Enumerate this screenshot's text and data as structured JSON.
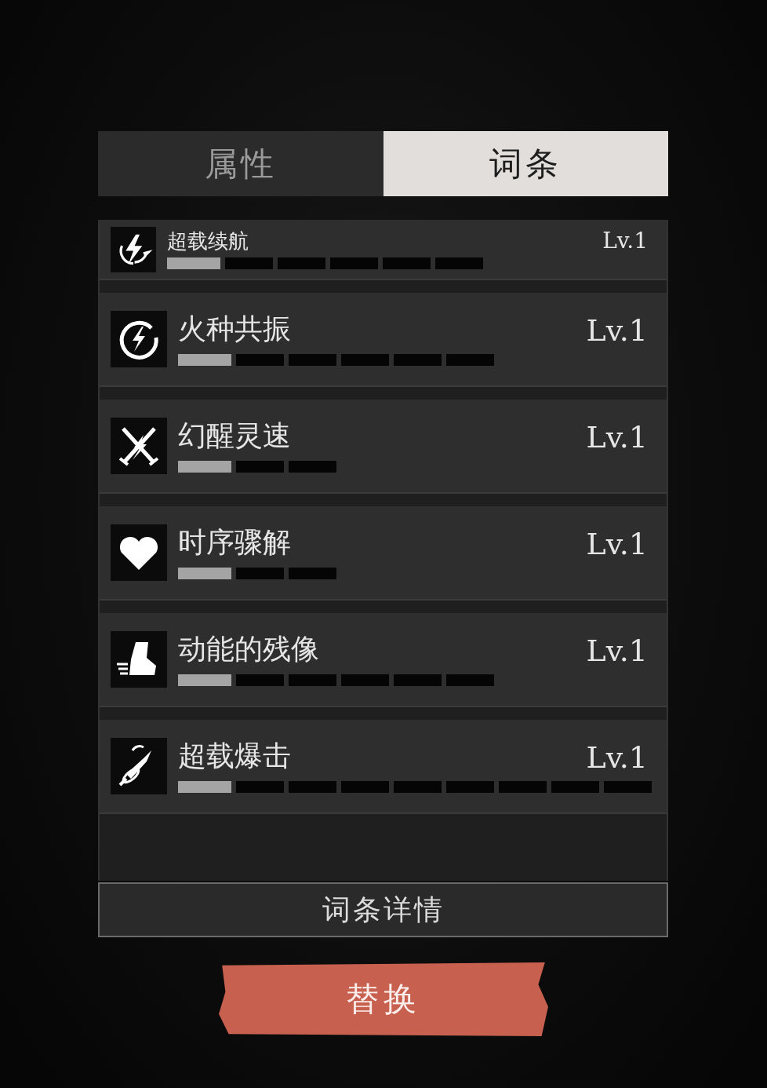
{
  "tabs": [
    {
      "label": "属性",
      "selected": false
    },
    {
      "label": "词条",
      "selected": true
    }
  ],
  "entries": [
    {
      "name": "超载续航",
      "level_text": "Lv.1",
      "pips": [
        {
          "filled": true
        },
        {
          "filled": false
        },
        {
          "filled": false
        },
        {
          "filled": false
        },
        {
          "filled": false
        },
        {
          "filled": false
        }
      ]
    },
    {
      "name": "火种共振",
      "level_text": "Lv.1",
      "pips": [
        {
          "filled": true
        },
        {
          "filled": false
        },
        {
          "filled": false
        },
        {
          "filled": false
        },
        {
          "filled": false
        },
        {
          "filled": false
        }
      ]
    },
    {
      "name": "幻醒灵速",
      "level_text": "Lv.1",
      "pips": [
        {
          "filled": true
        },
        {
          "filled": false
        },
        {
          "filled": false
        }
      ]
    },
    {
      "name": "时序骤解",
      "level_text": "Lv.1",
      "pips": [
        {
          "filled": true
        },
        {
          "filled": false
        },
        {
          "filled": false
        }
      ]
    },
    {
      "name": "动能的残像",
      "level_text": "Lv.1",
      "pips": [
        {
          "filled": true
        },
        {
          "filled": false
        },
        {
          "filled": false
        },
        {
          "filled": false
        },
        {
          "filled": false
        },
        {
          "filled": false
        }
      ]
    },
    {
      "name": "超载爆击",
      "level_text": "Lv.1",
      "pips": [
        {
          "filled": true
        },
        {
          "filled": false
        },
        {
          "filled": false
        },
        {
          "filled": false
        },
        {
          "filled": false
        },
        {
          "filled": false
        },
        {
          "filled": false
        },
        {
          "filled": false
        },
        {
          "filled": false
        }
      ]
    }
  ],
  "details_button": "词条详情",
  "replace_button": "替换"
}
